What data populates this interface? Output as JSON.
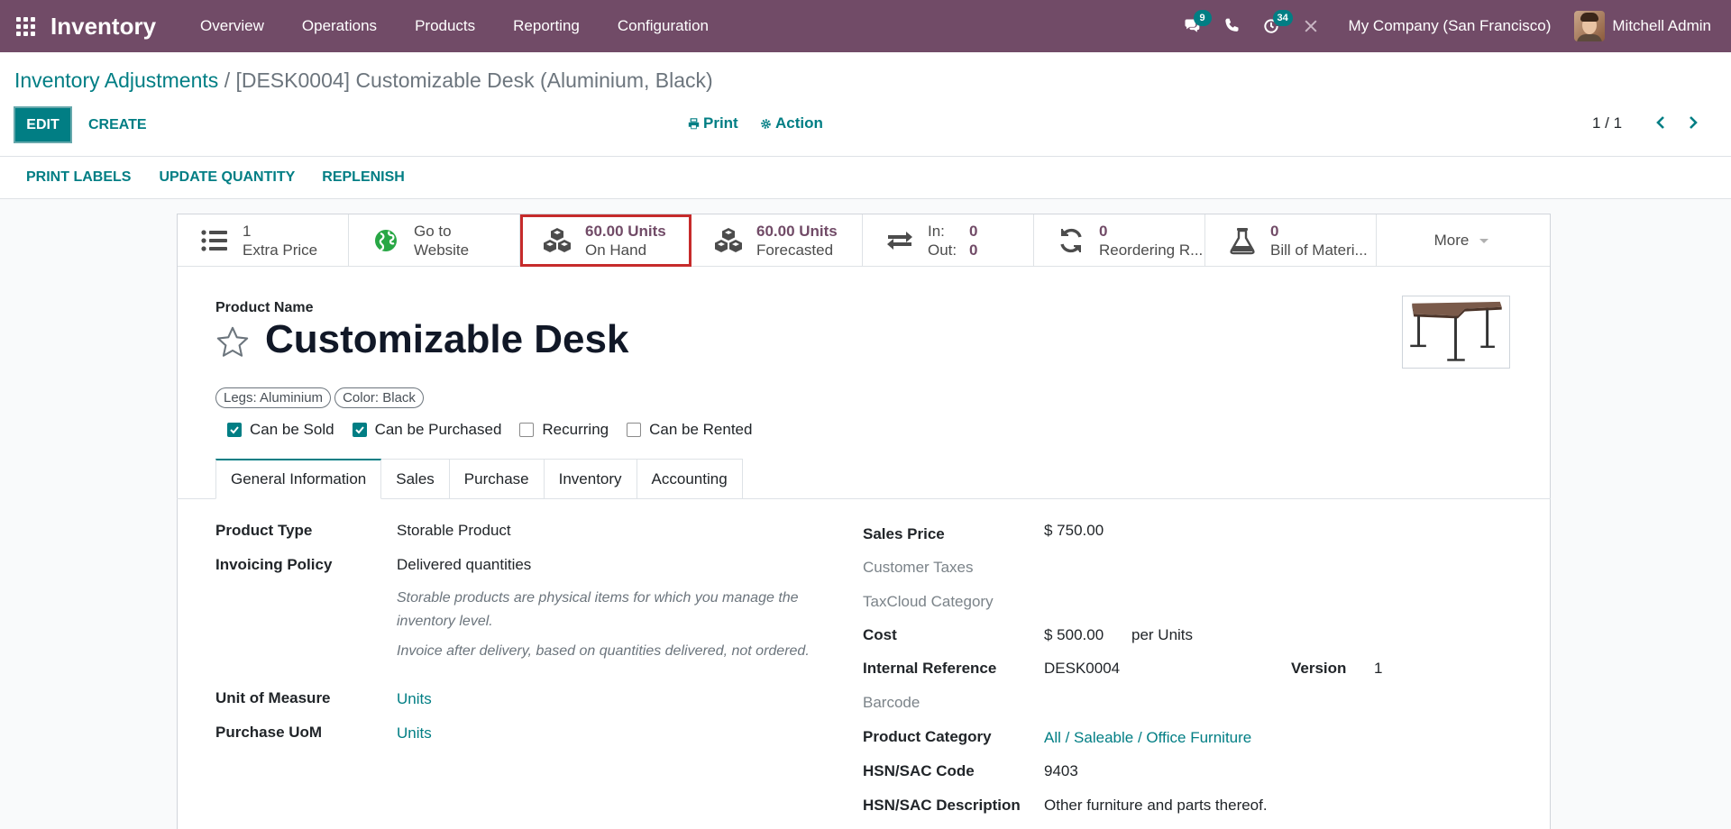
{
  "navbar": {
    "brand": "Inventory",
    "menu": [
      "Overview",
      "Operations",
      "Products",
      "Reporting",
      "Configuration"
    ],
    "messages_badge": "9",
    "activity_badge": "34",
    "company": "My Company (San Francisco)",
    "user": "Mitchell Admin"
  },
  "breadcrumb": {
    "parent": "Inventory Adjustments",
    "separator": "/",
    "current": "[DESK0004] Customizable Desk (Aluminium, Black)"
  },
  "buttons": {
    "edit": "EDIT",
    "create": "CREATE",
    "print": "Print",
    "action": "Action"
  },
  "pager": {
    "value": "1 / 1"
  },
  "statusbar": [
    "PRINT LABELS",
    "UPDATE QUANTITY",
    "REPLENISH"
  ],
  "smart_buttons": {
    "extra_price": {
      "value": "1",
      "label": "Extra Price"
    },
    "website": {
      "line1": "Go to",
      "line2": "Website"
    },
    "on_hand": {
      "value": "60.00 Units",
      "label": "On Hand"
    },
    "forecasted": {
      "value": "60.00 Units",
      "label": "Forecasted"
    },
    "in_out": {
      "in_label": "In:",
      "in_value": "0",
      "out_label": "Out:",
      "out_value": "0"
    },
    "reordering": {
      "value": "0",
      "label": "Reordering R..."
    },
    "bom": {
      "value": "0",
      "label": "Bill of Materi..."
    },
    "more": "More"
  },
  "product": {
    "name_label": "Product Name",
    "name": "Customizable Desk",
    "tags": [
      "Legs: Aluminium",
      "Color: Black"
    ],
    "checkboxes": [
      {
        "label": "Can be Sold",
        "checked": true
      },
      {
        "label": "Can be Purchased",
        "checked": true
      },
      {
        "label": "Recurring",
        "checked": false
      },
      {
        "label": "Can be Rented",
        "checked": false
      }
    ]
  },
  "tabs": [
    "General Information",
    "Sales",
    "Purchase",
    "Inventory",
    "Accounting"
  ],
  "general": {
    "product_type_label": "Product Type",
    "product_type": "Storable Product",
    "invoicing_policy_label": "Invoicing Policy",
    "invoicing_policy": "Delivered quantities",
    "help1": "Storable products are physical items for which you manage the inventory level.",
    "help2": "Invoice after delivery, based on quantities delivered, not ordered.",
    "uom_label": "Unit of Measure",
    "uom": "Units",
    "purchase_uom_label": "Purchase UoM",
    "purchase_uom": "Units",
    "sales_price_label": "Sales Price",
    "sales_price": "$ 750.00",
    "customer_taxes_label": "Customer Taxes",
    "taxcloud_label": "TaxCloud Category",
    "cost_label": "Cost",
    "cost": "$ 500.00",
    "cost_unit": "per Units",
    "internal_ref_label": "Internal Reference",
    "internal_ref": "DESK0004",
    "version_label": "Version",
    "version": "1",
    "barcode_label": "Barcode",
    "category_label": "Product Category",
    "category": "All / Saleable / Office Furniture",
    "hsn_code_label": "HSN/SAC Code",
    "hsn_code": "9403",
    "hsn_desc_label": "HSN/SAC Description",
    "hsn_desc": "Other furniture and parts thereof."
  },
  "colors": {
    "navbar": "#714b67",
    "primary": "#017e84",
    "highlight": "#c62b2b"
  }
}
